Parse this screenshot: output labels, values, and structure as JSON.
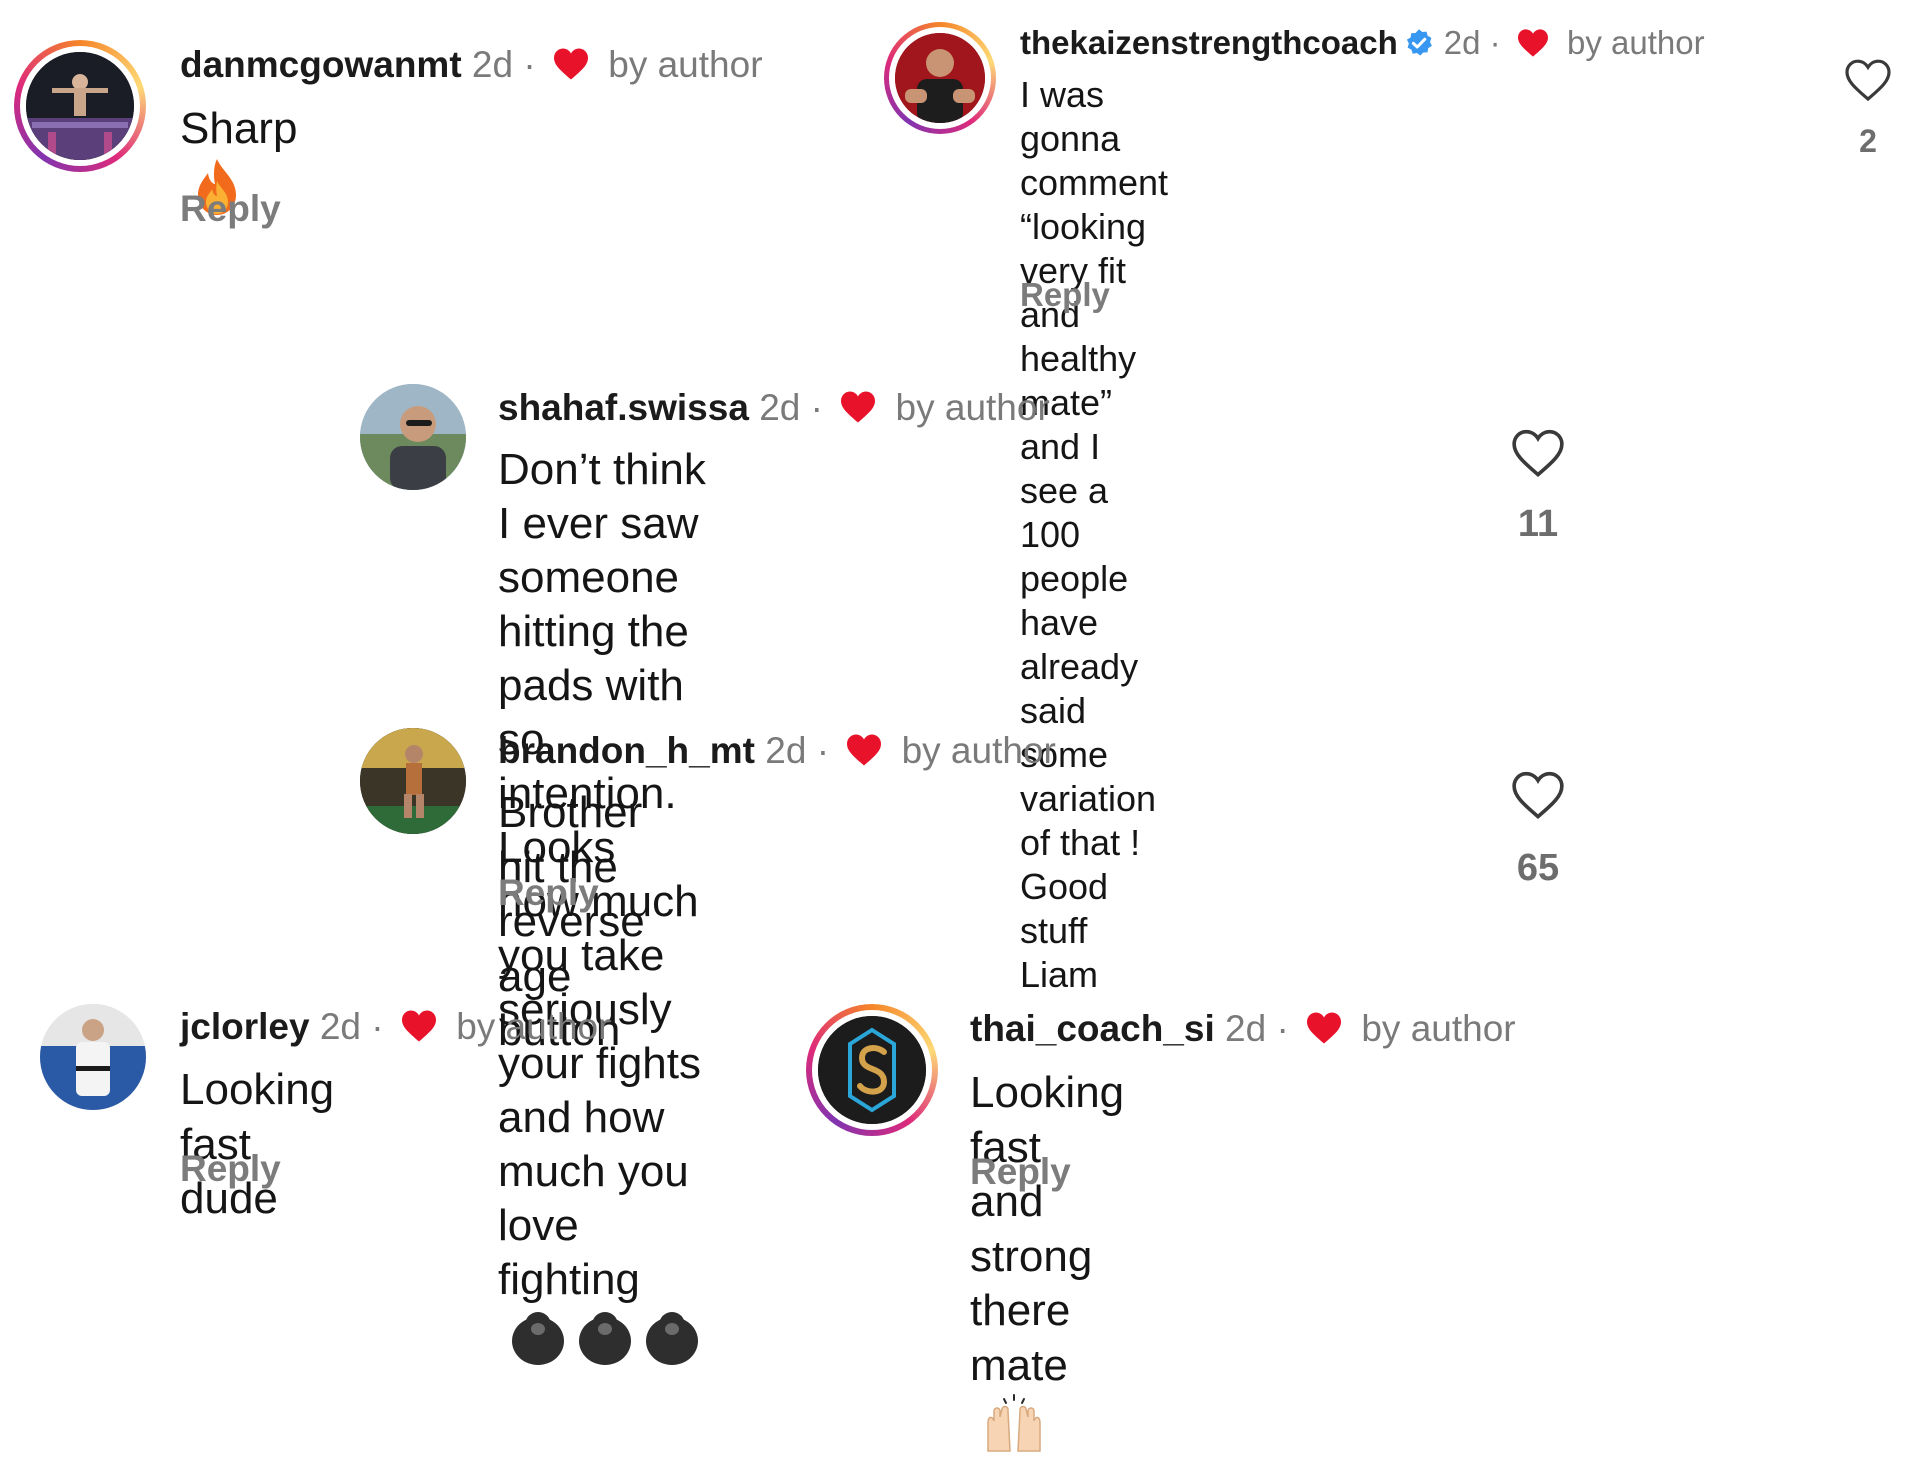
{
  "comments": [
    {
      "username": "danmcgowanmt",
      "time": "2d",
      "separator": "·",
      "liked_by": "by author",
      "text": "Sharp",
      "emoji": "fire",
      "reply_label": "Reply"
    },
    {
      "username": "thekaizenstrengthcoach",
      "verified": true,
      "time": "2d",
      "separator": "·",
      "liked_by": "by author",
      "text_lines": [
        "I was gonna comment “looking very fit and",
        "healthy mate” and I see a 100 people have",
        "already said some variation of that ! Good",
        "stuff Liam"
      ],
      "reply_label": "Reply",
      "likes": "2"
    },
    {
      "username": "shahaf.swissa",
      "time": "2d",
      "separator": "·",
      "liked_by": "by author",
      "text_lines": [
        "Don’t think I ever saw someone hitting the",
        "pads with so intention. Looks how much",
        "you take seriously your fights and how",
        "much you love fighting"
      ],
      "emoji": "gorilla x3",
      "likes": "11"
    },
    {
      "username": "brandon_h_mt",
      "time": "2d",
      "separator": "·",
      "liked_by": "by author",
      "text": "Brother hit the reverse age button",
      "reply_label": "Reply",
      "likes": "65"
    },
    {
      "username": "jclorley",
      "time": "2d",
      "separator": "·",
      "liked_by": "by author",
      "text": "Looking fast dude",
      "reply_label": "Reply"
    },
    {
      "username": "thai_coach_si",
      "time": "2d",
      "separator": "·",
      "liked_by": "by author",
      "text": "Looking fast and strong there mate",
      "emoji": "raising-hands",
      "reply_label": "Reply"
    }
  ],
  "colors": {
    "heart": "#e8132b",
    "verified": "#3897f0",
    "muted_text": "#7a7a7a"
  }
}
